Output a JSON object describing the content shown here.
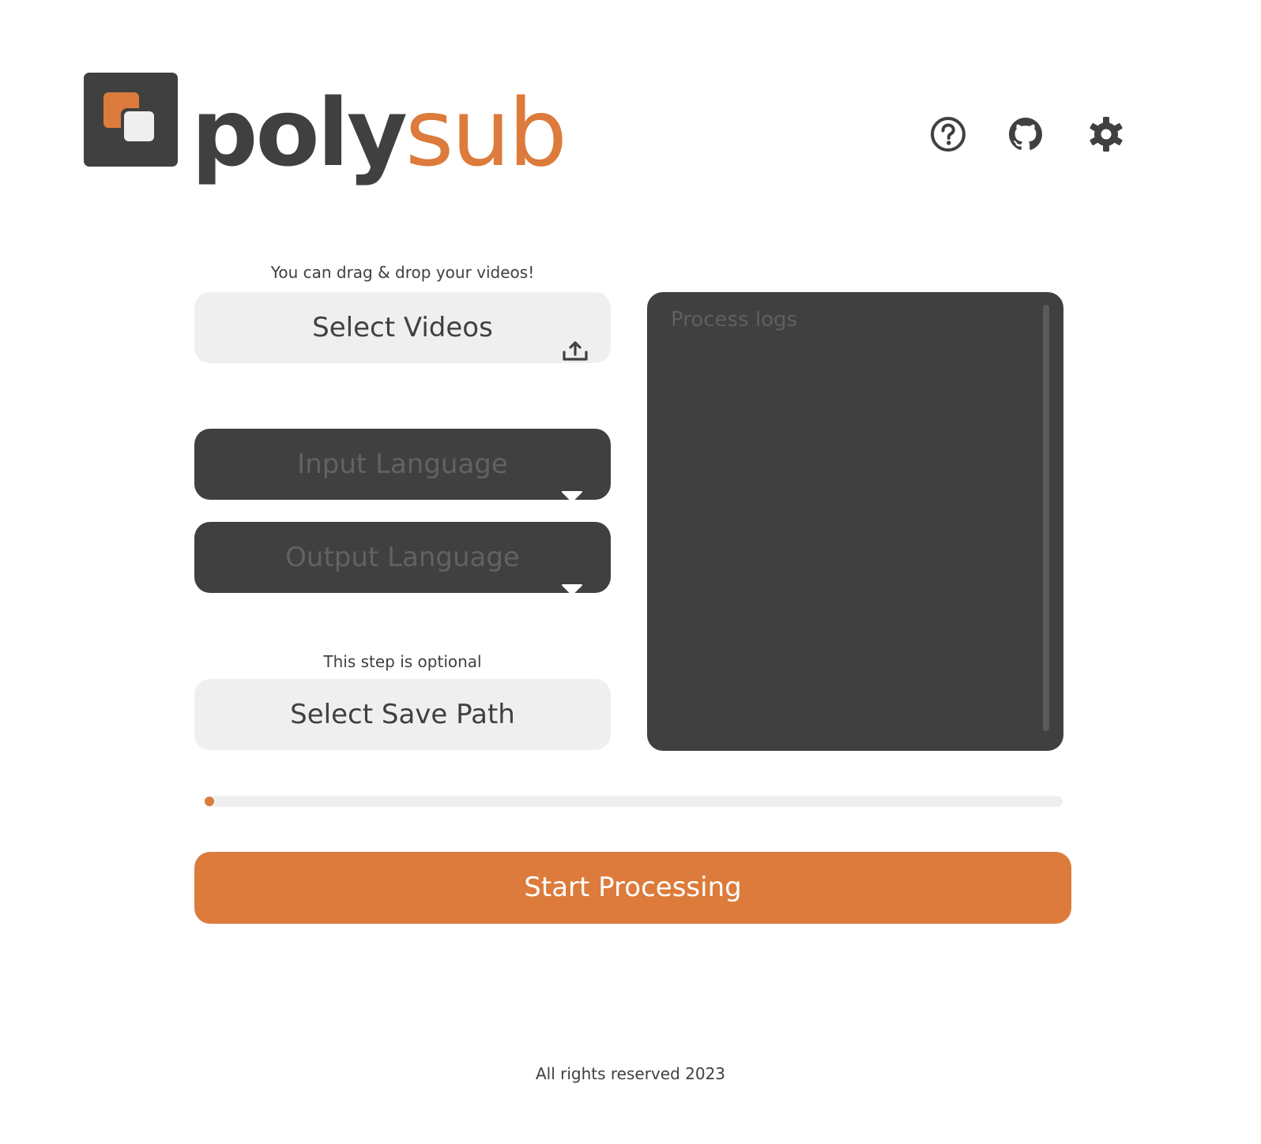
{
  "app": {
    "logo_poly": "poly",
    "logo_sub": "sub"
  },
  "header": {
    "icons": [
      "help-icon",
      "github-icon",
      "gear-icon"
    ]
  },
  "videos": {
    "hint": "You can drag & drop your videos!",
    "select_label": "Select Videos",
    "icon": "upload-icon"
  },
  "languages": {
    "input_placeholder": "Input Language",
    "output_placeholder": "Output Language",
    "icon": "chevron-down-icon"
  },
  "save_path": {
    "hint": "This step is optional",
    "select_label": "Select Save Path"
  },
  "logs": {
    "placeholder": "Process logs"
  },
  "progress": {
    "value_percent": 0
  },
  "actions": {
    "start_label": "Start Processing"
  },
  "footer": {
    "text": "All rights reserved  2023"
  },
  "colors": {
    "accent": "#dc7b3b",
    "dark": "#404040",
    "light": "#efefef",
    "background": "#ffffff"
  }
}
